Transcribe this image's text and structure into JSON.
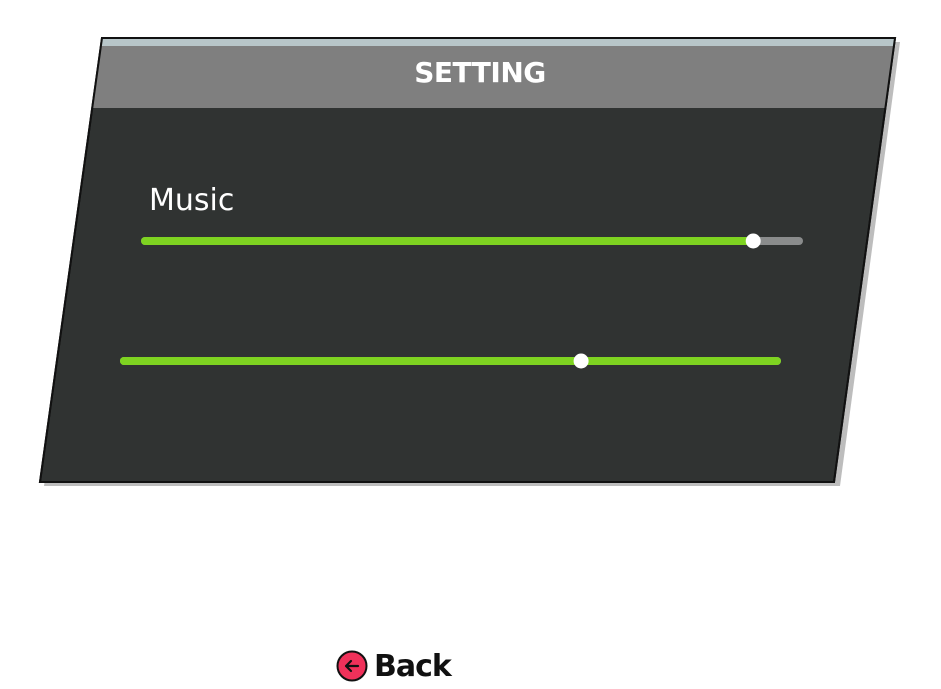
{
  "panel": {
    "title": "SETTING"
  },
  "sliders": [
    {
      "label": "Music",
      "value": 0.93
    },
    {
      "label": "",
      "value": 0.7
    }
  ],
  "back_button": {
    "label": "Back",
    "icon": "arrow-left-circle-icon"
  },
  "colors": {
    "panel_body": "#303332",
    "panel_header": "#7f7f7f",
    "track_fill": "#7ed321",
    "track_empty": "#8a8c8c",
    "knob": "#ffffff",
    "back_icon": "#f0315a"
  }
}
